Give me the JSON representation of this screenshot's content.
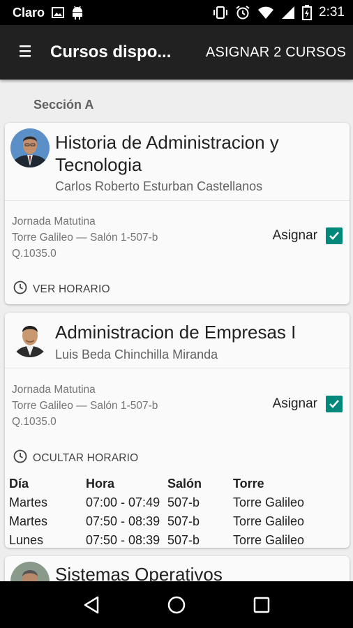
{
  "status_bar": {
    "carrier": "Claro",
    "time": "2:31"
  },
  "toolbar": {
    "title": "Cursos dispo...",
    "action_label": "ASIGNAR 2 CURSOS"
  },
  "section": {
    "label": "Sección A"
  },
  "courses": [
    {
      "title_line1": "Historia de Administracion y",
      "title_line2": "Tecnologia",
      "professor": "Carlos Roberto Esturban Castellanos",
      "jornada": "Jornada Matutina",
      "location": "Torre Galileo — Salón 1-507-b",
      "price": "Q.1035.0",
      "assign_label": "Asignar",
      "assigned": true,
      "schedule_toggle": "VER HORARIO"
    },
    {
      "title_line1": "Administracion de Empresas I",
      "professor": "Luis Beda Chinchilla Miranda",
      "jornada": "Jornada Matutina",
      "location": "Torre Galileo — Salón 1-507-b",
      "price": "Q.1035.0",
      "assign_label": "Asignar",
      "assigned": true,
      "schedule_toggle": "OCULTAR HORARIO",
      "schedule": {
        "headers": [
          "Día",
          "Hora",
          "Salón",
          "Torre"
        ],
        "rows": [
          [
            "Martes",
            "07:00 - 07:49",
            "507-b",
            "Torre Galileo"
          ],
          [
            "Martes",
            "07:50 - 08:39",
            "507-b",
            "Torre Galileo"
          ],
          [
            "Lunes",
            "07:50 - 08:39",
            "507-b",
            "Torre Galileo"
          ]
        ]
      }
    },
    {
      "title_line1": "Sistemas Operativos"
    }
  ],
  "colors": {
    "toolbar": "#212121",
    "checkbox": "#00897b",
    "background": "#eeeeee"
  },
  "icons": [
    "image-icon",
    "android-icon",
    "vibrate-icon",
    "alarm-icon",
    "wifi-icon",
    "signal-icon",
    "battery-icon",
    "menu-icon",
    "clock-icon",
    "check-icon",
    "back-icon",
    "home-icon",
    "recents-icon"
  ]
}
